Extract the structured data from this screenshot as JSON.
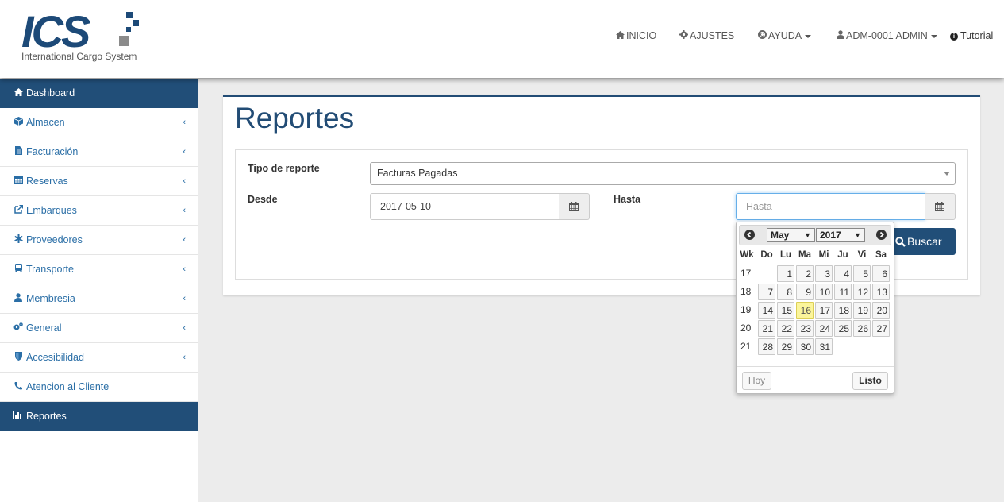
{
  "brand": {
    "logo_text": "ICS",
    "subtitle": "International Cargo System",
    "colors": {
      "primary": "#224c75",
      "accent_gray": "#8b8b8b"
    }
  },
  "topnav": {
    "inicio": "INICIO",
    "ajustes": "AJUSTES",
    "ayuda": "AYUDA",
    "user": "ADM-0001 ADMIN",
    "tutorial": "Tutorial",
    "icons": [
      "home-icon",
      "gear-icon",
      "lifebuoy-icon",
      "user-icon",
      "info-icon"
    ]
  },
  "sidebar": {
    "items": [
      {
        "label": "Dashboard",
        "icon": "home-icon",
        "active": true
      },
      {
        "label": "Almacen",
        "icon": "cube-icon"
      },
      {
        "label": "Facturación",
        "icon": "file-icon"
      },
      {
        "label": "Reservas",
        "icon": "calendar-icon"
      },
      {
        "label": "Embarques",
        "icon": "external-link-icon"
      },
      {
        "label": "Proveedores",
        "icon": "asterisk-icon"
      },
      {
        "label": "Transporte",
        "icon": "bus-icon"
      },
      {
        "label": "Membresia",
        "icon": "user-icon"
      },
      {
        "label": "General",
        "icon": "gears-icon"
      },
      {
        "label": "Accesibilidad",
        "icon": "shield-icon"
      },
      {
        "label": "Atencion al Cliente",
        "icon": "phone-icon"
      },
      {
        "label": "Reportes",
        "icon": "bar-chart-icon",
        "active": true
      }
    ],
    "chevron": "‹"
  },
  "main": {
    "title": "Reportes",
    "form": {
      "tipo_label": "Tipo de reporte",
      "tipo_value": "Facturas Pagadas",
      "desde_label": "Desde",
      "desde_value": "2017-05-10",
      "hasta_label": "Hasta",
      "hasta_placeholder": "Hasta",
      "buscar_label": "Buscar"
    }
  },
  "datepicker": {
    "month": "May",
    "year": "2017",
    "headers": [
      "Wk",
      "Do",
      "Lu",
      "Ma",
      "Mi",
      "Ju",
      "Vi",
      "Sa"
    ],
    "weeks": [
      {
        "wk": "17",
        "days": [
          "",
          "1",
          "2",
          "3",
          "4",
          "5",
          "6"
        ]
      },
      {
        "wk": "18",
        "days": [
          "7",
          "8",
          "9",
          "10",
          "11",
          "12",
          "13"
        ]
      },
      {
        "wk": "19",
        "days": [
          "14",
          "15",
          "16",
          "17",
          "18",
          "19",
          "20"
        ]
      },
      {
        "wk": "20",
        "days": [
          "21",
          "22",
          "23",
          "24",
          "25",
          "26",
          "27"
        ]
      },
      {
        "wk": "21",
        "days": [
          "28",
          "29",
          "30",
          "31",
          "",
          "",
          ""
        ]
      }
    ],
    "today": "16",
    "today_color": "#fbf59b",
    "btn_today": "Hoy",
    "btn_done": "Listo"
  }
}
